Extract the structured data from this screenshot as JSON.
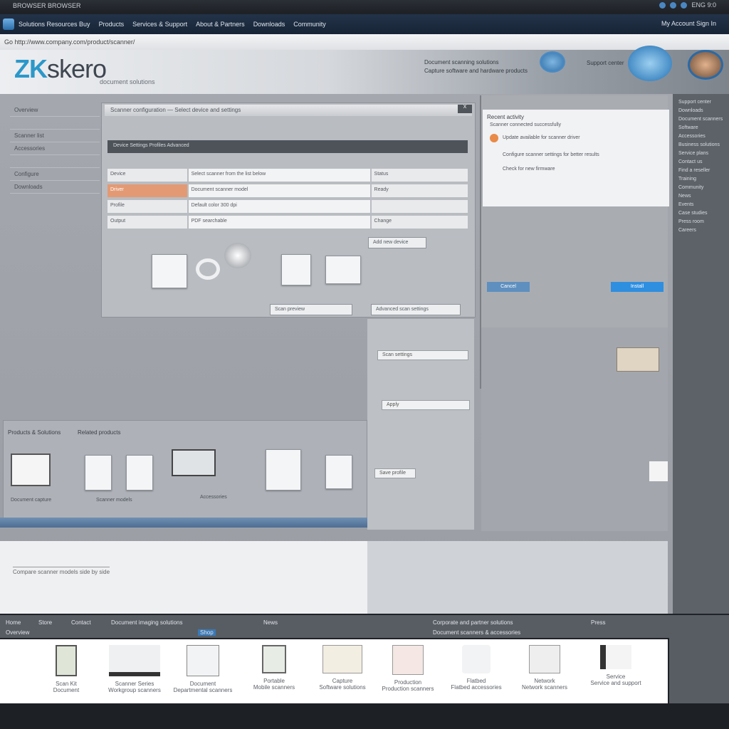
{
  "system_bar": {
    "left_text": "BROWSER  BROWSER",
    "right_text": "ENG  9:0"
  },
  "nav": {
    "items": [
      "Solutions  Resources  Buy",
      "Products",
      "Services & Support",
      "About & Partners",
      "Downloads",
      "Community"
    ],
    "right_text": "My Account  Sign In"
  },
  "address": {
    "text": "Go  http://www.company.com/product/scanner/"
  },
  "hero": {
    "logo_a": "ZK",
    "logo_b": "skero",
    "tagline": "document solutions",
    "links": [
      "Document scanning solutions",
      "Capture software and hardware products"
    ],
    "mid_text": "Support center"
  },
  "leftnav": {
    "items": [
      "Overview",
      "",
      "Scanner list",
      "Accessories",
      "",
      "Configure",
      "Downloads"
    ]
  },
  "dialog": {
    "title": "Scanner configuration — Select device and settings",
    "close": "X",
    "tabbar": "Device   Settings   Profiles   Advanced",
    "rows": [
      [
        "Device",
        "Select scanner from the list below",
        "Status"
      ],
      [
        "Driver",
        "Document scanner model",
        "Ready"
      ],
      [
        "Profile",
        "Default color 300 dpi",
        ""
      ],
      [
        "Output",
        "PDF searchable",
        "Change"
      ]
    ],
    "side_button": "Add new device",
    "bottom_btn_1": "Scan preview",
    "bottom_btn_2": "Advanced scan settings"
  },
  "right_panel": {
    "header": "Recent activity",
    "subheader": "Scanner connected successfully",
    "items": [
      "Update available for scanner driver",
      "Configure scanner settings for better results",
      "Check for new firmware"
    ],
    "left_button": "Cancel",
    "right_button": "Install"
  },
  "mid_strip": {
    "buttons": [
      "Scan settings",
      "Apply",
      "Save profile"
    ]
  },
  "lower": {
    "title": "Products & Solutions",
    "subtitle": "Related products",
    "captions": [
      "Document capture",
      "Scanner models",
      "Accessories"
    ]
  },
  "white_area": {
    "text": "Compare scanner models side by side"
  },
  "rightcol": {
    "items": [
      "Support center",
      "Downloads",
      "Document scanners",
      "Software",
      "Accessories",
      "Business solutions",
      "Service plans",
      "Contact us",
      "Find a reseller",
      "Training",
      "Community",
      "News",
      "Events",
      "Case studies",
      "Press room",
      "Careers"
    ]
  },
  "footnav": {
    "row1": [
      "Home",
      "Store",
      "Contact",
      "Document imaging solutions",
      "News",
      "Corporate and partner solutions",
      "Press"
    ],
    "row2": [
      "Overview",
      "Shop",
      "Document scanners & accessories"
    ]
  },
  "products": [
    {
      "name": "Scan Kit",
      "sub": "Document"
    },
    {
      "name": "Scanner Series",
      "sub": "Workgroup scanners"
    },
    {
      "name": "Document",
      "sub": "Departmental scanners"
    },
    {
      "name": "Portable",
      "sub": "Mobile scanners"
    },
    {
      "name": "Capture",
      "sub": "Software solutions"
    },
    {
      "name": "Production",
      "sub": "Production scanners"
    },
    {
      "name": "Flatbed",
      "sub": "Flatbed accessories"
    },
    {
      "name": "Network",
      "sub": "Network scanners"
    },
    {
      "name": "Service",
      "sub": "Service and support"
    }
  ]
}
